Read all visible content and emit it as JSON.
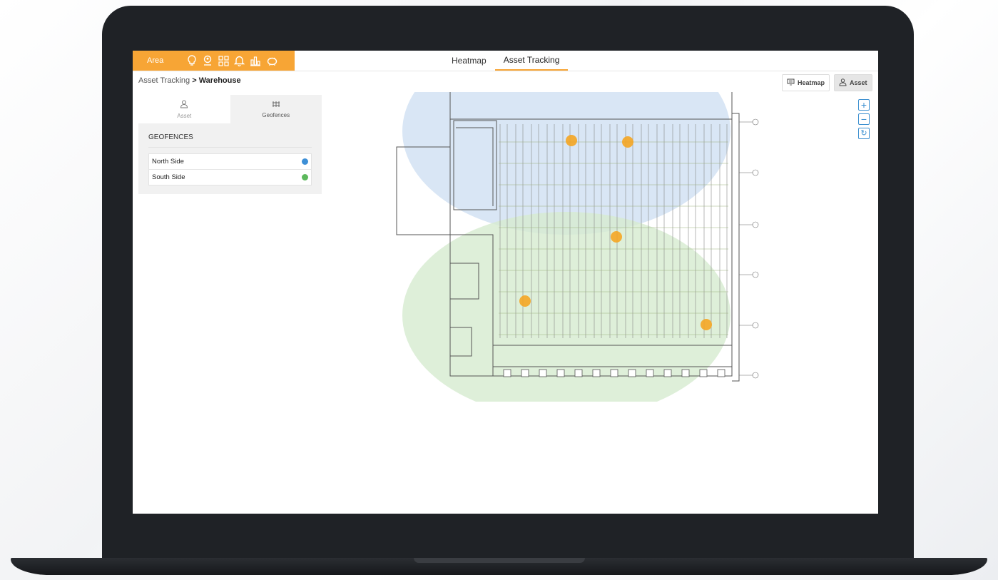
{
  "topbar": {
    "area_label": "Area",
    "icons": [
      "lightbulb-icon",
      "location-user-icon",
      "grid-icon",
      "bell-icon",
      "bar-chart-icon",
      "piggy-bank-icon"
    ],
    "tabs": [
      {
        "label": "Heatmap",
        "active": false
      },
      {
        "label": "Asset Tracking",
        "active": true
      }
    ]
  },
  "breadcrumb": {
    "parent": "Asset Tracking",
    "separator": ">",
    "current": "Warehouse"
  },
  "view_toggle": {
    "heatmap_label": "Heatmap",
    "asset_label": "Asset"
  },
  "zoom": {
    "in": "+",
    "out": "−",
    "reset": "↻"
  },
  "panel": {
    "tabs": [
      {
        "label": "Asset",
        "icon": "person-icon",
        "active": false
      },
      {
        "label": "Geofences",
        "icon": "fence-icon",
        "active": true
      }
    ],
    "heading": "GEOFENCES",
    "geofences": [
      {
        "name": "North Side",
        "color": "#3d8fd6"
      },
      {
        "name": "South Side",
        "color": "#5cb85c"
      }
    ]
  },
  "colors": {
    "accent": "#f7a535",
    "north_zone": "#cfe0f2",
    "south_zone": "#d6ebcf",
    "asset_marker": "#f5a623"
  }
}
